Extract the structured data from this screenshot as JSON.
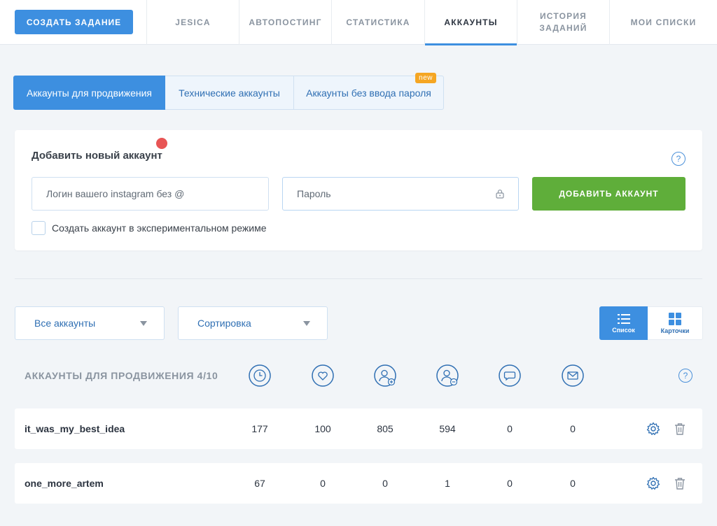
{
  "topnav": {
    "create_label": "СОЗДАТЬ ЗАДАНИЕ",
    "tabs": [
      {
        "label": "JESICA"
      },
      {
        "label": "АВТОПОСТИНГ"
      },
      {
        "label": "СТАТИСТИКА"
      },
      {
        "label": "АККАУНТЫ"
      },
      {
        "label": "ИСТОРИЯ\nЗАДАНИЙ"
      },
      {
        "label": "МОИ СПИСКИ"
      }
    ],
    "active_tab": "АККАУНТЫ"
  },
  "account_tabs": [
    {
      "label": "Аккаунты для продвижения"
    },
    {
      "label": "Технические аккаунты"
    },
    {
      "label": "Аккаунты без ввода пароля",
      "badge": "new"
    }
  ],
  "add_account": {
    "title": "Добавить новый аккаунт",
    "help": "?",
    "login_placeholder": "Логин вашего instagram без @",
    "password_placeholder": "Пароль",
    "add_label": "ДОБАВИТЬ АККАУНТ",
    "experimental_label": "Создать аккаунт в экспериментальном режиме"
  },
  "filters": {
    "accounts_select": "Все аккаунты",
    "sort_select": "Сортировка",
    "view_list": "Список",
    "view_cards": "Карточки"
  },
  "table": {
    "title": "АККАУНТЫ ДЛЯ ПРОДВИЖЕНИЯ 4/10",
    "help": "?",
    "columns": [
      "clock-icon",
      "heart-icon",
      "user-plus-icon",
      "user-minus-icon",
      "comment-icon",
      "mail-icon"
    ],
    "rows": [
      {
        "name": "it_was_my_best_idea",
        "values": [
          "177",
          "100",
          "805",
          "594",
          "0",
          "0"
        ]
      },
      {
        "name": "one_more_artem",
        "values": [
          "67",
          "0",
          "0",
          "1",
          "0",
          "0"
        ]
      }
    ]
  },
  "colors": {
    "accent": "#3d8fe0",
    "success": "#5fae3a",
    "badge": "#f5a623",
    "alert": "#e85555"
  }
}
